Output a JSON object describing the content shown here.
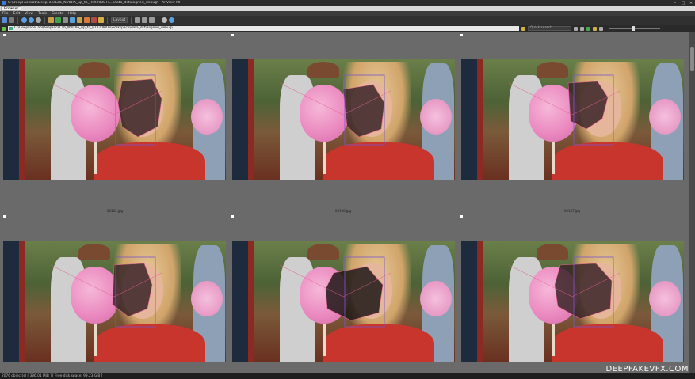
{
  "window": {
    "title": "C:\\DeepFaceLab\\DeepFaceLab_NVIDIA_up_to_RTX2080Ti\\...\\data_dst\\aligned_debug\\ - XnView MP",
    "min": "–",
    "max": "□",
    "close": "✕"
  },
  "tabs": [
    "Browser"
  ],
  "menu": [
    "File",
    "Edit",
    "View",
    "Tools",
    "Create",
    "Help"
  ],
  "toolbar": {
    "layout_dd": "Layout"
  },
  "path": {
    "value": "C:\\DeepFaceLab\\DeepFaceLab_NVIDIA_up_to_RTX2080Ti\\workspace\\data_dst\\aligned_debug\\",
    "search_placeholder": "Quick search"
  },
  "thumbnails": [
    {
      "caption": "00162.jpg",
      "face_shade": "#3a2628"
    },
    {
      "caption": "00196.jpg",
      "face_shade": "#3a2628"
    },
    {
      "caption": "00187.jpg",
      "face_shade": "#3a2628"
    },
    {
      "caption": "",
      "face_shade": "#3a2628"
    },
    {
      "caption": "",
      "face_shade": "#1e1816"
    },
    {
      "caption": "",
      "face_shade": "#3a2628"
    }
  ],
  "status": {
    "text": "2076 object(s) [ 386.01 MiB ] [ Free disk space: 99.23 GiB ]"
  },
  "watermark": "DEEPFAKEVFX.COM",
  "colors": {
    "viewer_bg": "#6a6a6a",
    "landmark": "#7a56c8",
    "landmark2": "#e0608a"
  }
}
